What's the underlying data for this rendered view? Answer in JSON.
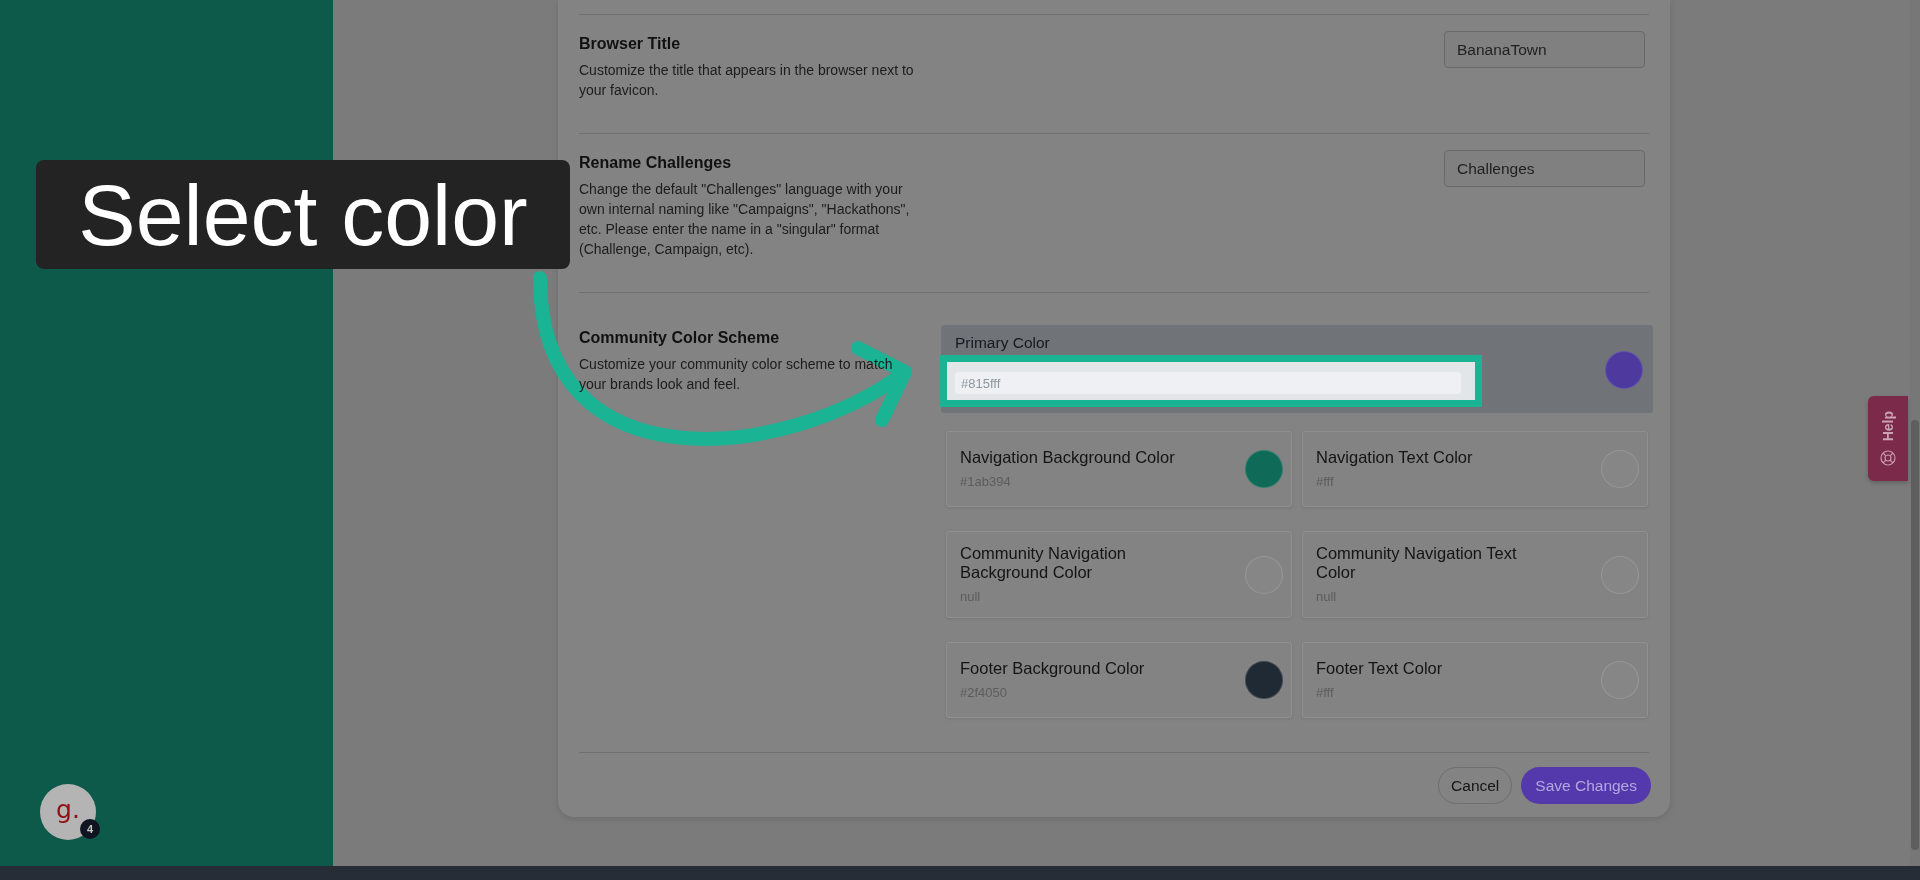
{
  "sidebar": {
    "avatar": {
      "initials": "g.",
      "badge": "4"
    }
  },
  "settings": [
    {
      "title": "Browser Title",
      "description": "Customize the title that appears in the browser next to your favicon.",
      "value": "BananaTown"
    },
    {
      "title": "Rename Challenges",
      "description": "Change the default \"Challenges\" language with your own internal naming like \"Campaigns\", \"Hackathons\", etc. Please enter the name in a \"singular\" format (Challenge, Campaign, etc).",
      "value": "Challenges"
    }
  ],
  "color_scheme": {
    "title": "Community Color Scheme",
    "description": "Customize your community color scheme to match your brands look and feel.",
    "primary": {
      "label": "Primary Color",
      "value": "#815fff",
      "color": "#4e3a9e"
    },
    "colors": [
      {
        "label": "Navigation Background Color",
        "value": "#1ab394",
        "color": "#0f6b58"
      },
      {
        "label": "Navigation Text Color",
        "value": "#fff",
        "color": "#868686"
      },
      {
        "label": "Community Navigation Background Color",
        "value": "null",
        "color": "#868686"
      },
      {
        "label": "Community Navigation Text Color",
        "value": "null",
        "color": "#868686"
      },
      {
        "label": "Footer Background Color",
        "value": "#2f4050",
        "color": "#1f2a35"
      },
      {
        "label": "Footer Text Color",
        "value": "#fff",
        "color": "#868686"
      }
    ]
  },
  "actions": {
    "cancel": "Cancel",
    "save": "Save Changes"
  },
  "tutorial": {
    "caption": "Select color"
  },
  "help_tab": {
    "label": "Help"
  }
}
